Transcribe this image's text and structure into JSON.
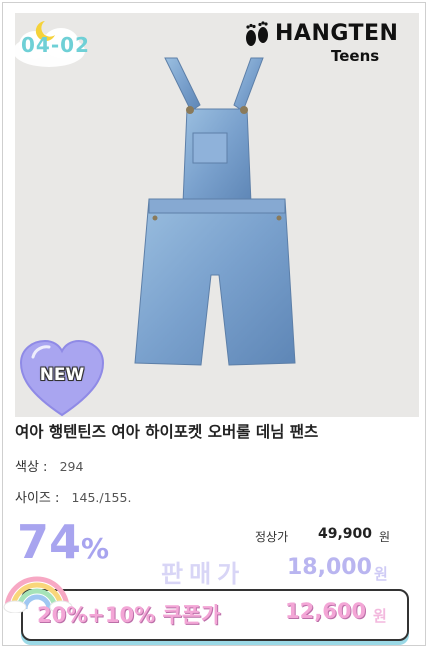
{
  "date_tag": "04-02",
  "brand": {
    "main": "HANGTEN",
    "sub": "Teens",
    "icon": "footprints-icon"
  },
  "badge": {
    "label": "NEW",
    "color": "#a9a5f0"
  },
  "product": {
    "title": "여아 행텐틴즈 여아 하이포켓 오버롤 데님 팬츠",
    "color_label": "색상 :",
    "color_value": "294",
    "size_label": "사이즈 :",
    "size_value": "145./155."
  },
  "pricing": {
    "discount_number": "74",
    "discount_symbol": "%",
    "original_label": "정상가",
    "original_price": "49,900",
    "original_unit": "원",
    "sale_label": "판매가",
    "sale_price": "18,000",
    "sale_unit": "원",
    "coupon_label": "20%+10% 쿠폰가",
    "coupon_price": "12,600",
    "coupon_unit": "원"
  },
  "colors": {
    "accent": "#a8a4ef",
    "coupon_pink": "#f3a6d6",
    "date_teal": "#6fd0d6",
    "denim": "#7da4cf"
  }
}
